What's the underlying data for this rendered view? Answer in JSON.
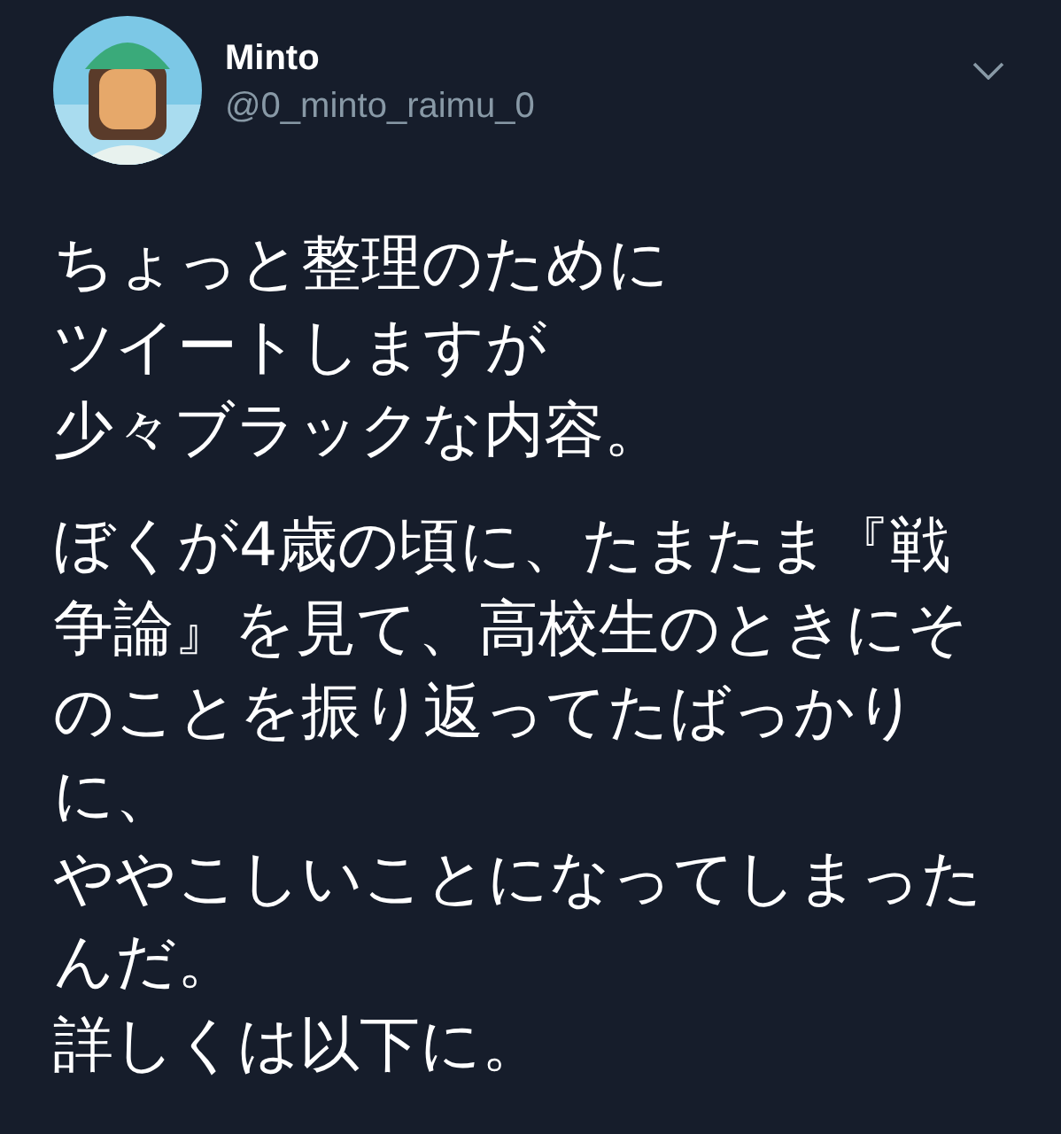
{
  "tweet": {
    "author": {
      "name": "Minto",
      "handle": "@0_minto_raimu_0"
    },
    "paragraphs": [
      [
        "ちょっと整理のために",
        "ツイートしますが",
        "少々ブラックな内容。"
      ],
      [
        "ぼくが4歳の頃に、たまたま『戦争論』を見て、高校生のときにそのことを振り返ってたばっかりに、",
        "ややこしいことになってしまったんだ。",
        "詳しくは以下に。"
      ]
    ]
  }
}
